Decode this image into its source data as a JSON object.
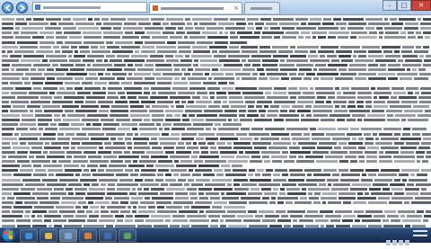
{
  "window": {
    "address_bar": {
      "icon": "page-favicon-icon"
    },
    "tabs": [
      {
        "state": "active",
        "icon": "page-favicon-icon"
      },
      {
        "state": "inactive"
      }
    ],
    "controls": {
      "minimize": "–",
      "maximize": "□",
      "close": "✕"
    }
  },
  "page": {
    "background": "#ffffff",
    "text_colors": [
      "#3a3f48",
      "#6b7280",
      "#333a44"
    ]
  },
  "taskbar": {
    "start_icon": "windows-start-icon",
    "apps": [
      {
        "name": "ie-icon",
        "color": "#3b8fd6"
      },
      {
        "name": "folder-icon",
        "color": "#e3b64a"
      },
      {
        "name": "browser-icon",
        "color": "#7aa9d8"
      },
      {
        "name": "media-icon",
        "color": "#e07b39"
      },
      {
        "name": "word-icon",
        "color": "#3c6fb8"
      },
      {
        "name": "chrome-icon",
        "color": "#58a55c"
      }
    ]
  }
}
